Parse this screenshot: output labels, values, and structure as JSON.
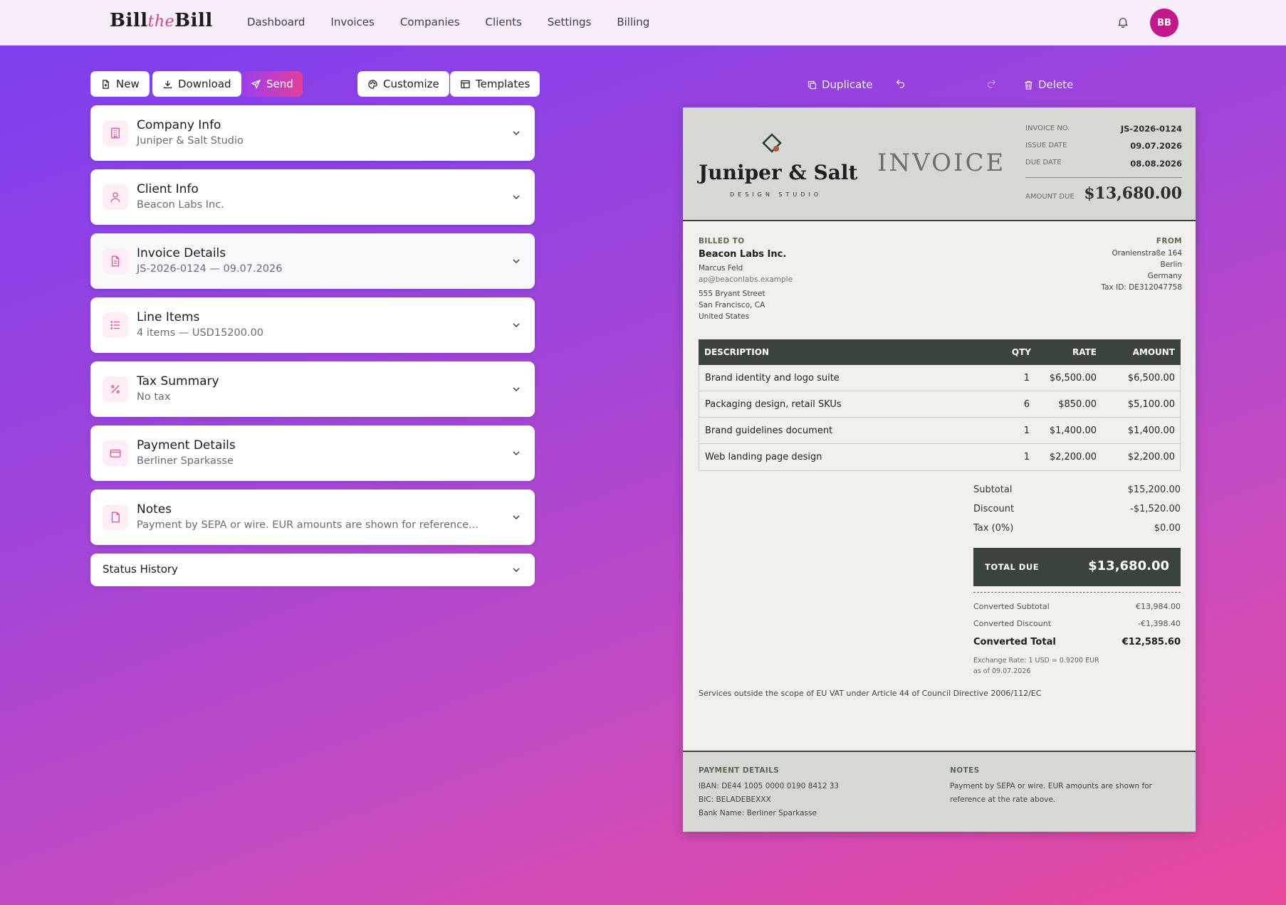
{
  "app": {
    "logo_a": "Bill",
    "logo_the": "the",
    "logo_b": "Bill",
    "nav": [
      "Dashboard",
      "Invoices",
      "Companies",
      "Clients",
      "Settings",
      "Billing"
    ],
    "avatar": "BB"
  },
  "toolbar": {
    "new": "New",
    "download": "Download",
    "send": "Send",
    "customize": "Customize",
    "templates": "Templates"
  },
  "panels": [
    {
      "title": "Company Info",
      "subtitle": "Juniper & Salt Studio"
    },
    {
      "title": "Client Info",
      "subtitle": "Beacon Labs Inc."
    },
    {
      "title": "Invoice Details",
      "subtitle": "JS-2026-0124 — 09.07.2026"
    },
    {
      "title": "Line Items",
      "subtitle": "4 items — USD15200.00"
    },
    {
      "title": "Tax Summary",
      "subtitle": "No tax"
    },
    {
      "title": "Payment Details",
      "subtitle": "Berliner Sparkasse"
    },
    {
      "title": "Notes",
      "subtitle": "Payment by SEPA or wire. EUR amounts are shown for reference..."
    }
  ],
  "status_history": "Status History",
  "preview_toolbar": {
    "duplicate": "Duplicate",
    "delete": "Delete"
  },
  "invoice": {
    "brand": "Juniper & Salt",
    "brand_sub": "DESIGN STUDIO",
    "word": "INVOICE",
    "meta": [
      {
        "label": "INVOICE NO.",
        "value": "JS-2026-0124"
      },
      {
        "label": "ISSUE DATE",
        "value": "09.07.2026"
      },
      {
        "label": "DUE DATE",
        "value": "08.08.2026"
      }
    ],
    "amount_due_label": "AMOUNT DUE",
    "amount_due": "$13,680.00",
    "billed_to_label": "BILLED TO",
    "client_name": "Beacon Labs Inc.",
    "client_contact": "Marcus Feld",
    "client_email": "ap@beaconlabs.example",
    "client_address": [
      "555 Bryant Street",
      "San Francisco, CA",
      "United States"
    ],
    "from_label": "FROM",
    "from_address": [
      "Oranienstraße 164",
      "Berlin",
      "Germany",
      "Tax ID: DE312047758"
    ],
    "columns": [
      "DESCRIPTION",
      "QTY",
      "RATE",
      "AMOUNT"
    ],
    "items": [
      {
        "desc": "Brand identity and logo suite",
        "qty": "1",
        "rate": "$6,500.00",
        "amount": "$6,500.00"
      },
      {
        "desc": "Packaging design, retail SKUs",
        "qty": "6",
        "rate": "$850.00",
        "amount": "$5,100.00"
      },
      {
        "desc": "Brand guidelines document",
        "qty": "1",
        "rate": "$1,400.00",
        "amount": "$1,400.00"
      },
      {
        "desc": "Web landing page design",
        "qty": "1",
        "rate": "$2,200.00",
        "amount": "$2,200.00"
      }
    ],
    "subtotal_label": "Subtotal",
    "subtotal": "$15,200.00",
    "discount_label": "Discount",
    "discount": "-$1,520.00",
    "tax_label": "Tax (0%)",
    "tax": "$0.00",
    "total_label": "TOTAL DUE",
    "total": "$13,680.00",
    "conv_subtotal_label": "Converted Subtotal",
    "conv_subtotal": "€13,984.00",
    "conv_discount_label": "Converted Discount",
    "conv_discount": "-€1,398.40",
    "conv_total_label": "Converted Total",
    "conv_total": "€12,585.60",
    "exchange_rate": "Exchange Rate: 1 USD = 0.9200 EUR",
    "exchange_date": "as of 09.07.2026",
    "vat_note": "Services outside the scope of EU VAT under Article 44 of Council Directive 2006/112/EC",
    "payment_label": "PAYMENT DETAILS",
    "payment_lines": [
      "IBAN: DE44 1005 0000 0190 8412 33",
      "BIC: BELADEBEXXX",
      "Bank Name: Berliner Sparkasse"
    ],
    "notes_label": "NOTES",
    "notes_lines": [
      "Payment by SEPA or wire. EUR amounts are shown for",
      "reference at the rate above."
    ]
  },
  "colors": {
    "accent": "#c2188a",
    "doc_dark": "#3a443b",
    "doc_header": "#d5d8d3"
  }
}
